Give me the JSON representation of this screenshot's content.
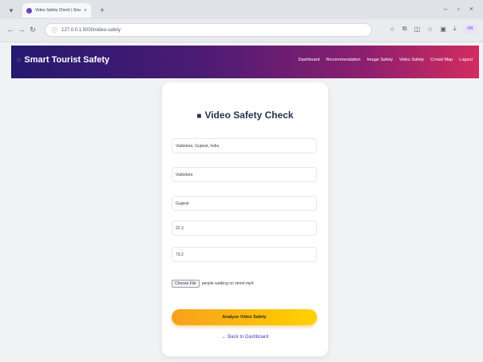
{
  "browser": {
    "tab_title": "Video Safety Check | Smart Tourist Safety",
    "new_tab_symbol": "+",
    "url": "127.0.0.1:5000/video-safety",
    "avatar_label": "Off"
  },
  "app": {
    "brand": "Smart Tourist Safety",
    "nav": [
      "Dashboard",
      "Recommendation",
      "Image Safety",
      "Video Safety",
      "Crowd Map",
      "Logout"
    ]
  },
  "form": {
    "title": "Video Safety Check",
    "fields": [
      {
        "value": "Vadodara, Gujarat, India"
      },
      {
        "value": "Vadodara"
      },
      {
        "value": "Gujarat"
      },
      {
        "value": "22.3"
      },
      {
        "value": "73.2"
      }
    ],
    "file": {
      "button_label": "Choose File",
      "file_name": "people walking on street.mp4"
    },
    "submit_label": "Analyze Video Safety",
    "back_link": "← Back to Dashboard"
  },
  "colors": {
    "navbar_start": "#25196f",
    "navbar_end": "#d22c5f",
    "button_start": "#f7a01c",
    "button_end": "#ffd200"
  }
}
